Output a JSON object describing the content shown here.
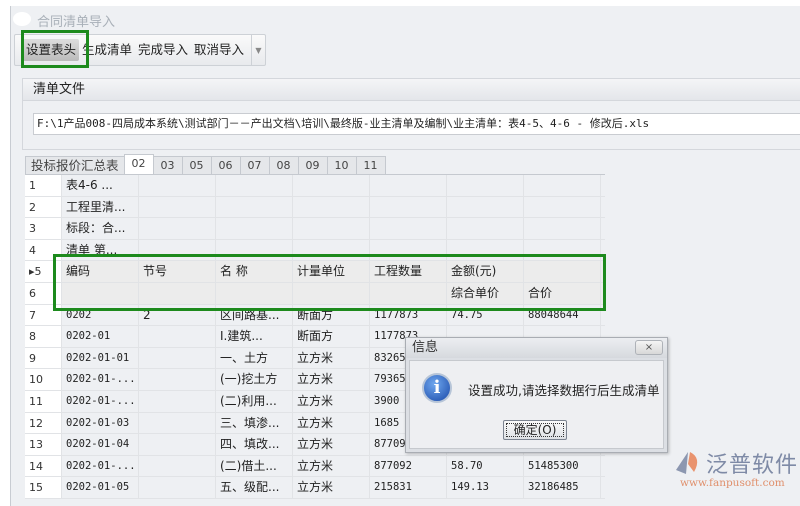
{
  "window": {
    "title": "合同清单导入"
  },
  "toolbar": {
    "buttons": [
      "设置表头",
      "生成清单",
      "完成导入",
      "取消导入"
    ]
  },
  "file_panel": {
    "label": "清单文件",
    "path": "F:\\1产品008-四局成本系统\\测试部门－－产出文档\\培训\\最终版-业主清单及编制\\业主清单：表4-5、4-6 - 修改后.xls"
  },
  "tabs": [
    "投标报价汇总表",
    "02",
    "03",
    "05",
    "06",
    "07",
    "08",
    "09",
    "10",
    "11"
  ],
  "grid": {
    "rows": [
      {
        "n": "1",
        "c": [
          "表4-6    ...",
          "",
          "",
          "",
          "",
          "",
          ""
        ]
      },
      {
        "n": "2",
        "c": [
          "工程里清...",
          "",
          "",
          "",
          "",
          "",
          ""
        ]
      },
      {
        "n": "3",
        "c": [
          "标段：合...",
          "",
          "",
          "",
          "",
          "",
          ""
        ]
      },
      {
        "n": "4",
        "c": [
          "清单  第...",
          "",
          "",
          "",
          "",
          "",
          ""
        ]
      },
      {
        "n": "▸5",
        "c": [
          "编码",
          "节号",
          "名  称",
          "计量单位",
          "工程数量",
          "金额(元)",
          ""
        ]
      },
      {
        "n": "6",
        "c": [
          "",
          "",
          "",
          "",
          "",
          "综合单价",
          "合价"
        ]
      },
      {
        "n": "7",
        "c": [
          "0202",
          "2",
          "区间路基...",
          "断面方",
          "1177873",
          "74.75",
          "88048644"
        ]
      },
      {
        "n": "8",
        "c": [
          "0202-01",
          "",
          "Ⅰ.建筑...",
          "断面方",
          "1177873",
          "",
          ""
        ]
      },
      {
        "n": "9",
        "c": [
          "0202-01-01",
          "",
          "一、土方",
          "立方米",
          "83265",
          "",
          ""
        ]
      },
      {
        "n": "10",
        "c": [
          "0202-01-...",
          "",
          "(一)挖土方",
          "立方米",
          "79365",
          "",
          ""
        ]
      },
      {
        "n": "11",
        "c": [
          "0202-01-...",
          "",
          "(二)利用...",
          "立方米",
          "3900",
          "",
          ""
        ]
      },
      {
        "n": "12",
        "c": [
          "0202-01-03",
          "",
          "三、填渗...",
          "立方米",
          "1685",
          "",
          ""
        ]
      },
      {
        "n": "13",
        "c": [
          "0202-01-04",
          "",
          "四、填改...",
          "立方米",
          "87709",
          "",
          ""
        ]
      },
      {
        "n": "14",
        "c": [
          "0202-01-...",
          "",
          "(二)借土...",
          "立方米",
          "877092",
          "58.70",
          "51485300"
        ]
      },
      {
        "n": "15",
        "c": [
          "0202-01-05",
          "",
          "五、级配...",
          "立方米",
          "215831",
          "149.13",
          "32186485"
        ]
      }
    ]
  },
  "dialog": {
    "title": "信息",
    "close": "×",
    "message": "设置成功,请选择数据行后生成清单",
    "ok": "确定(O)"
  },
  "watermark": {
    "name": "泛普软件",
    "url": "www.fanpusoft.com"
  },
  "colors": {
    "highlight": "#1d8a1d"
  }
}
